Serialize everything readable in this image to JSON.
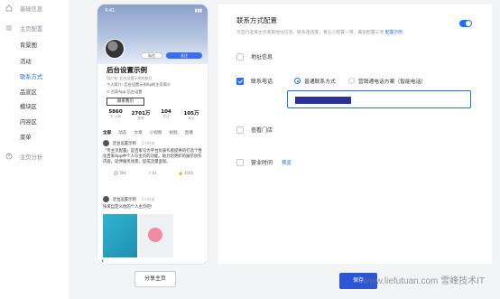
{
  "sidebar": {
    "items": [
      {
        "label": "基础信息",
        "state": "muted"
      },
      {
        "label": "主页配置",
        "state": "muted"
      },
      {
        "label": "背景图",
        "state": "normal"
      },
      {
        "label": "活动",
        "state": "normal"
      },
      {
        "label": "联系方式",
        "state": "active"
      },
      {
        "label": "品宣区",
        "state": "normal"
      },
      {
        "label": "模块区",
        "state": "normal"
      },
      {
        "label": "内容区",
        "state": "normal"
      },
      {
        "label": "菜单",
        "state": "normal"
      },
      {
        "label": "主页分析",
        "state": "muted"
      }
    ]
  },
  "preview": {
    "shop_name": "后台设置示例",
    "shop_sub": "用户名: 后台设置示例的账号",
    "shop_desc": "个人简介: 后台设置示例Ap的主页简介",
    "shop_tag": "⊙ 百家App 后台设置",
    "btn1": "私信",
    "btn2": "关注",
    "contact_button": "联系我们",
    "stats": [
      {
        "num": "5860",
        "lbl": "万·公粉"
      },
      {
        "num": "2701万",
        "lbl": "获赞"
      },
      {
        "num": "104",
        "lbl": "关注"
      },
      {
        "num": "105万",
        "lbl": "粉丝"
      }
    ],
    "tabs": [
      "全部",
      "动态",
      "文章",
      "小视频",
      "视频",
      "直播"
    ],
    "post1": {
      "author": "后台设置示例",
      "time": "·2小时前",
      "text": "「专主页配置」是百家号为平台优质作者提供的打造个性化百家App中个人号主页的功能。助力您更好的展示创作内容，延伸服务场景，促成流量变现。",
      "actions": [
        "396",
        "63",
        "3500"
      ]
    },
    "post2": {
      "author": "后台设置示例",
      "time": "·2小时前",
      "text": "快来自定义你的个人主页吧!"
    }
  },
  "share_button": "分享主页",
  "settings": {
    "title": "联系方式配置",
    "desc": "可自行选择主页底部地址信息、联系电话等，看五小配置一项，最多配置三项",
    "desc_link": "配置示例",
    "toggle_on": true,
    "options": [
      {
        "label": "地址信息",
        "checked": false
      },
      {
        "label": "联系电话",
        "checked": true
      },
      {
        "label": "查看门店",
        "checked": false
      },
      {
        "label": "营业时间",
        "checked": false
      }
    ],
    "phone_radio_1": "普通联系方式",
    "phone_radio_2": "营销通电话方案（智能电话）",
    "preview_link": "预览"
  },
  "save_button": "保存",
  "watermark": "www.liefutuan.com 雪峰技术IT"
}
